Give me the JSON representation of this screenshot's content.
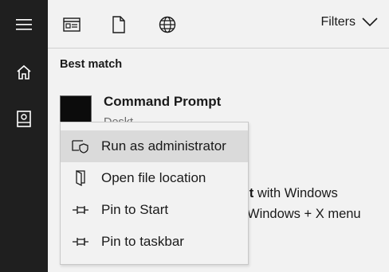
{
  "sidebar": {
    "items": [
      {
        "icon": "hamburger-menu-icon"
      },
      {
        "icon": "home-icon"
      },
      {
        "icon": "notebook-icon"
      }
    ]
  },
  "topbar": {
    "icons": [
      "apps-icon",
      "documents-icon",
      "web-icon"
    ],
    "filters_label": "Filters"
  },
  "results": {
    "section_title": "Best match",
    "app_name": "Command Prompt",
    "app_type": "Deskt",
    "description_line1_bold": "mpt",
    "description_line1_rest": " with Windows",
    "description_line2": "Windows + X menu"
  },
  "context_menu": {
    "items": [
      {
        "label": "Run as administrator",
        "icon": "shield-icon",
        "highlighted": true
      },
      {
        "label": "Open file location",
        "icon": "file-location-icon"
      },
      {
        "label": "Pin to Start",
        "icon": "pin-icon"
      },
      {
        "label": "Pin to taskbar",
        "icon": "pin-icon"
      }
    ]
  },
  "colors": {
    "sidebar_bg": "#1f1f1f",
    "panel_bg": "#f2f2f2",
    "highlight_bg": "#dadada"
  }
}
